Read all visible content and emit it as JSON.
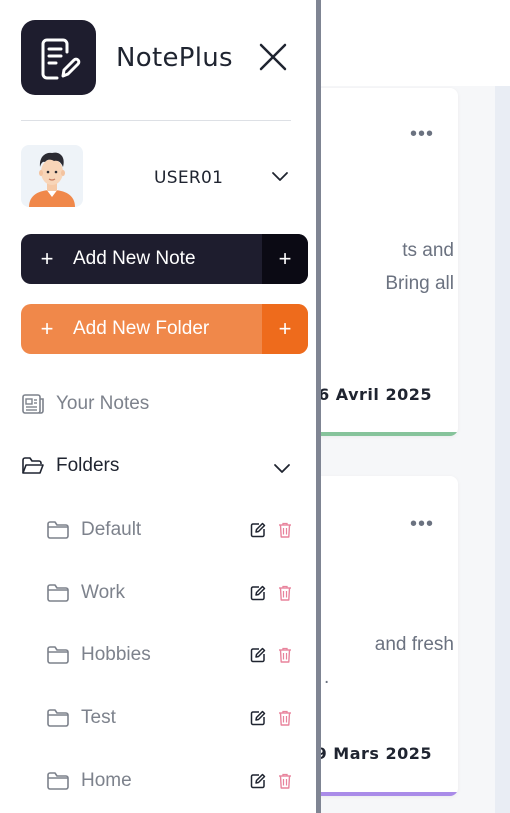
{
  "app": {
    "name": "NotePlus"
  },
  "user": {
    "name": "USER01"
  },
  "actions": {
    "add_note_label": "Add New Note",
    "add_folder_label": "Add New Folder",
    "plus": "+"
  },
  "nav": {
    "your_notes_label": "Your Notes",
    "folders_label": "Folders"
  },
  "folders": [
    {
      "name": "Default"
    },
    {
      "name": "Work"
    },
    {
      "name": "Hobbies"
    },
    {
      "name": "Test"
    },
    {
      "name": "Home"
    }
  ],
  "background_notes": [
    {
      "snippet_lines": [
        "ts and",
        "Bring all"
      ],
      "date": "6 Avril 2025",
      "accent": "#86c39b"
    },
    {
      "snippet_lines": [
        "and fresh",
        "."
      ],
      "date": "9 Mars 2025",
      "accent": "#a98be8"
    }
  ],
  "colors": {
    "brand_dark": "#1e1d2e",
    "accent_orange": "#f0884a",
    "trash_pink": "#e8839c"
  }
}
